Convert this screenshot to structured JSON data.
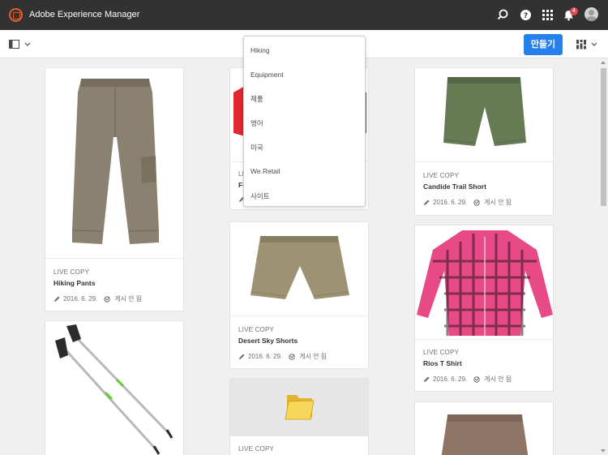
{
  "app": {
    "title": "Adobe Experience Manager"
  },
  "topbar": {
    "icons": [
      "search-icon",
      "help-icon",
      "solutions-icon",
      "notifications-icon",
      "user-avatar"
    ],
    "notification_count": "4"
  },
  "actionbar": {
    "create_label": "만들기",
    "rail_icon": "rail-toggle-icon",
    "view_icon": "card-view-icon"
  },
  "breadcrumb_menu": {
    "items": [
      "Hiking",
      "Equipment",
      "제품",
      "영어",
      "미국",
      "We.Retail",
      "사이트"
    ]
  },
  "cards": [
    {
      "kind": "LIVE COPY",
      "title": "Hiking Pants",
      "date": "2016. 6. 29.",
      "status": "게시 안 됨"
    },
    {
      "kind": "LIVE COPY",
      "title": "Fi",
      "date": "",
      "status": ""
    },
    {
      "kind": "LIVE COPY",
      "title": "Candide Trail Short",
      "date": "2016. 6. 29.",
      "status": "게시 안 됨"
    },
    {
      "kind": "LIVE COPY",
      "title": "Desert Sky Shorts",
      "date": "2016. 6. 29.",
      "status": "게시 안 됨"
    },
    {
      "kind": "LIVE COPY",
      "title": "Rios T Shirt",
      "date": "2016. 6. 29.",
      "status": "게시 안 됨"
    },
    {
      "kind": "",
      "title": "",
      "date": "",
      "status": ""
    },
    {
      "kind": "LIVE COPY",
      "title": "",
      "date": "",
      "status": ""
    },
    {
      "kind": "",
      "title": "",
      "date": "",
      "status": ""
    }
  ],
  "colors": {
    "topbar": "#323232",
    "accent": "#2680eb",
    "background": "#f0f0f0",
    "logo": "#e35c2f",
    "badge": "#e34850"
  }
}
